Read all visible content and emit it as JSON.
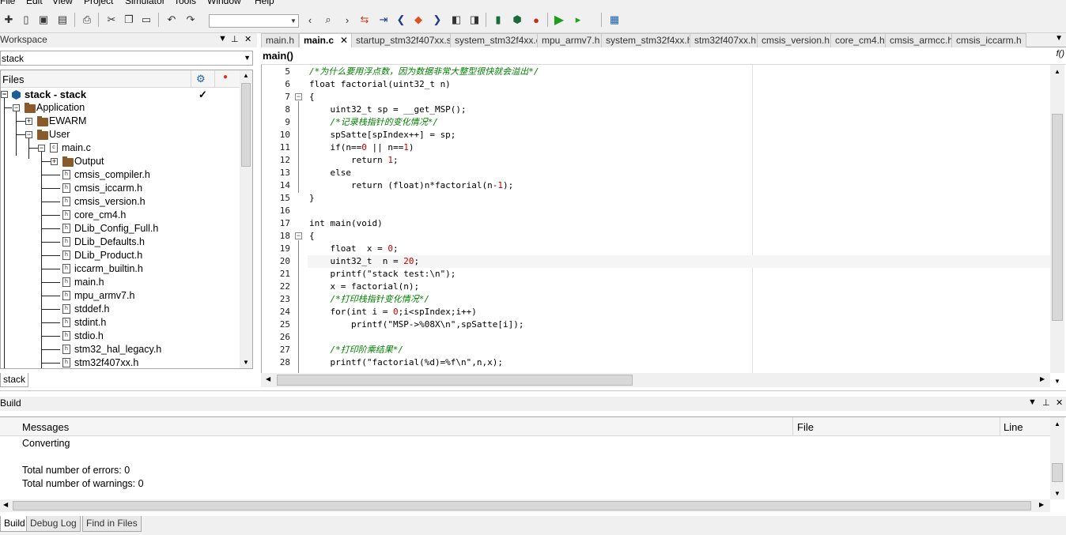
{
  "menu": [
    "File",
    "Edit",
    "View",
    "Project",
    "Simulator",
    "Tools",
    "Window",
    "Help"
  ],
  "workspace": {
    "title": "Workspace",
    "selector_value": "stack",
    "files_header": "Files",
    "bottom_tab": "stack",
    "tree": [
      {
        "label": "stack - stack",
        "kind": "project",
        "checked": "✓"
      },
      {
        "label": "Application",
        "kind": "folder"
      },
      {
        "label": "EWARM",
        "kind": "folder"
      },
      {
        "label": "User",
        "kind": "folder"
      },
      {
        "label": "main.c",
        "kind": "cfile"
      },
      {
        "label": "Output",
        "kind": "folder"
      },
      {
        "label": "cmsis_compiler.h",
        "kind": "hfile"
      },
      {
        "label": "cmsis_iccarm.h",
        "kind": "hfile"
      },
      {
        "label": "cmsis_version.h",
        "kind": "hfile"
      },
      {
        "label": "core_cm4.h",
        "kind": "hfile"
      },
      {
        "label": "DLib_Config_Full.h",
        "kind": "hfile"
      },
      {
        "label": "DLib_Defaults.h",
        "kind": "hfile"
      },
      {
        "label": "DLib_Product.h",
        "kind": "hfile"
      },
      {
        "label": "iccarm_builtin.h",
        "kind": "hfile"
      },
      {
        "label": "main.h",
        "kind": "hfile"
      },
      {
        "label": "mpu_armv7.h",
        "kind": "hfile"
      },
      {
        "label": "stddef.h",
        "kind": "hfile"
      },
      {
        "label": "stdint.h",
        "kind": "hfile"
      },
      {
        "label": "stdio.h",
        "kind": "hfile"
      },
      {
        "label": "stm32_hal_legacy.h",
        "kind": "hfile"
      },
      {
        "label": "stm32f407xx.h",
        "kind": "hfile"
      }
    ]
  },
  "editor": {
    "tabs": [
      "main.h",
      "main.c",
      "startup_stm32f407xx.s",
      "system_stm32f4xx.c",
      "mpu_armv7.h",
      "system_stm32f4xx.h",
      "stm32f407xx.h",
      "cmsis_version.h",
      "core_cm4.h",
      "cmsis_armcc.h",
      "cmsis_iccarm.h"
    ],
    "active_tab": "main.c",
    "function_label": "main()",
    "function_icon": "f()",
    "lines": [
      {
        "n": "5",
        "t": "/*为什么要用浮点数，因为数据非常大整型很快就会溢出*/"
      },
      {
        "n": "6",
        "t": "float factorial(uint32_t n)"
      },
      {
        "n": "7",
        "t": "{"
      },
      {
        "n": "8",
        "t": "    uint32_t sp = __get_MSP();"
      },
      {
        "n": "9",
        "t": "    /*记录栈指针的变化情况*/"
      },
      {
        "n": "10",
        "t": "    spSatte[spIndex++] = sp;"
      },
      {
        "n": "11",
        "t": "    if(n==0 || n==1)"
      },
      {
        "n": "12",
        "t": "        return 1;"
      },
      {
        "n": "13",
        "t": "    else"
      },
      {
        "n": "14",
        "t": "        return (float)n*factorial(n-1);"
      },
      {
        "n": "15",
        "t": "}"
      },
      {
        "n": "16",
        "t": ""
      },
      {
        "n": "17",
        "t": "int main(void)"
      },
      {
        "n": "18",
        "t": "{"
      },
      {
        "n": "19",
        "t": "    float  x = 0;"
      },
      {
        "n": "20",
        "t": "    uint32_t  n = 20;"
      },
      {
        "n": "21",
        "t": "    printf(\"stack test:\\n\");"
      },
      {
        "n": "22",
        "t": "    x = factorial(n);"
      },
      {
        "n": "23",
        "t": "    /*打印栈指针变化情况*/"
      },
      {
        "n": "24",
        "t": "    for(int i = 0;i<spIndex;i++)"
      },
      {
        "n": "25",
        "t": "        printf(\"MSP->%08X\\n\",spSatte[i]);"
      },
      {
        "n": "26",
        "t": ""
      },
      {
        "n": "27",
        "t": "    /*打印阶乘结果*/"
      },
      {
        "n": "28",
        "t": "    printf(\"factorial(%d)=%f\\n\",n,x);"
      }
    ]
  },
  "build": {
    "title": "Build",
    "col_messages": "Messages",
    "col_file": "File",
    "col_line": "Line",
    "messages": [
      "Converting",
      "",
      "Total number of errors: 0",
      "Total number of warnings: 0"
    ],
    "tabs": [
      "Build",
      "Debug Log",
      "Find in Files"
    ]
  },
  "colors": {
    "comment": "#008000",
    "number": "#c00000",
    "project_icon": "#1c5e9a",
    "folder": "#8b5a2b"
  }
}
